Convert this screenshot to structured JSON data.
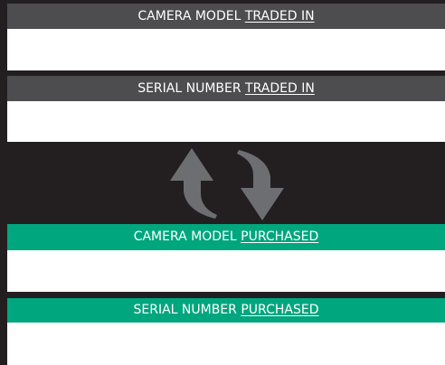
{
  "trade_in": {
    "model": {
      "label_prefix": "CAMERA MODEL",
      "label_emphasis": "TRADED IN",
      "value": ""
    },
    "serial": {
      "label_prefix": "SERIAL NUMBER",
      "label_emphasis": "TRADED IN",
      "value": ""
    }
  },
  "purchase": {
    "model": {
      "label_prefix": "CAMERA MODEL",
      "label_emphasis": "PURCHASED",
      "value": ""
    },
    "serial": {
      "label_prefix": "SERIAL NUMBER",
      "label_emphasis": "PURCHASED",
      "value": ""
    }
  },
  "icons": {
    "exchange": "swap-arrows-icon"
  },
  "colors": {
    "background": "#231f20",
    "trade_in_header": "#4d4d4f",
    "purchase_header": "#00a67e",
    "field": "#ffffff",
    "icon": "#6d6e71"
  }
}
